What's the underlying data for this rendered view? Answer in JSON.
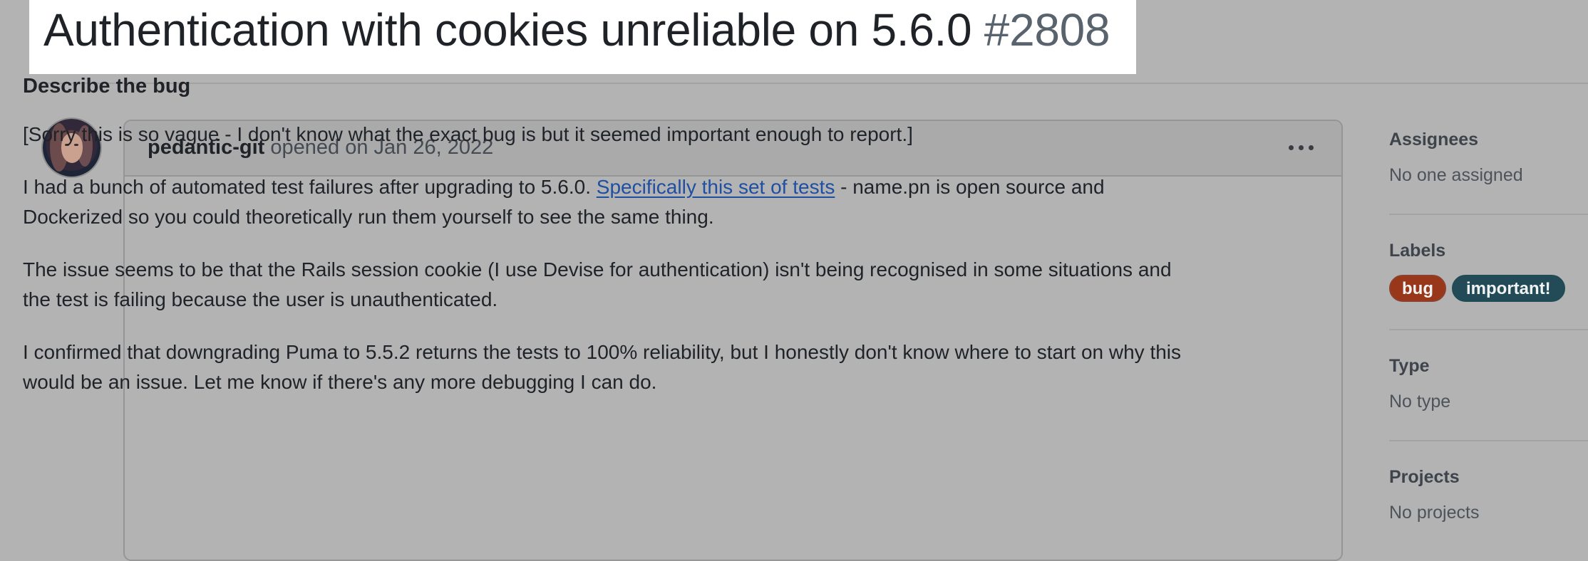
{
  "issue": {
    "title": "Authentication with cookies unreliable on 5.6.0",
    "number": "#2808"
  },
  "comment": {
    "author": "pedantic-git",
    "opened_text": "opened on Jan 26, 2022",
    "heading": "Describe the bug",
    "paragraph_1": "[Sorry this is so vague - I don't know what the exact bug is but it seemed important enough to report.]",
    "paragraph_2_prefix": "I had a bunch of automated test failures after upgrading to 5.6.0. ",
    "paragraph_2_link": "Specifically this set of tests",
    "paragraph_2_suffix": " - name.pn is open source and Dockerized so you could theoretically run them yourself to see the same thing.",
    "paragraph_3": "The issue seems to be that the Rails session cookie (I use Devise for authentication) isn't being recognised in some situations and the test is failing because the user is unauthenticated.",
    "paragraph_4": "I confirmed that downgrading Puma to 5.5.2 returns the tests to 100% reliability, but I honestly don't know where to start on why this would be an issue. Let me know if there's any more debugging I can do."
  },
  "sidebar": {
    "assignees_title": "Assignees",
    "assignees_value": "No one assigned",
    "labels_title": "Labels",
    "labels": [
      {
        "name": "bug",
        "color": "#98371a"
      },
      {
        "name": "important!",
        "color": "#224b57"
      }
    ],
    "type_title": "Type",
    "type_value": "No type",
    "projects_title": "Projects",
    "projects_value": "No projects"
  },
  "icons": {
    "comment_actions": "kebab-horizontal-icon"
  }
}
